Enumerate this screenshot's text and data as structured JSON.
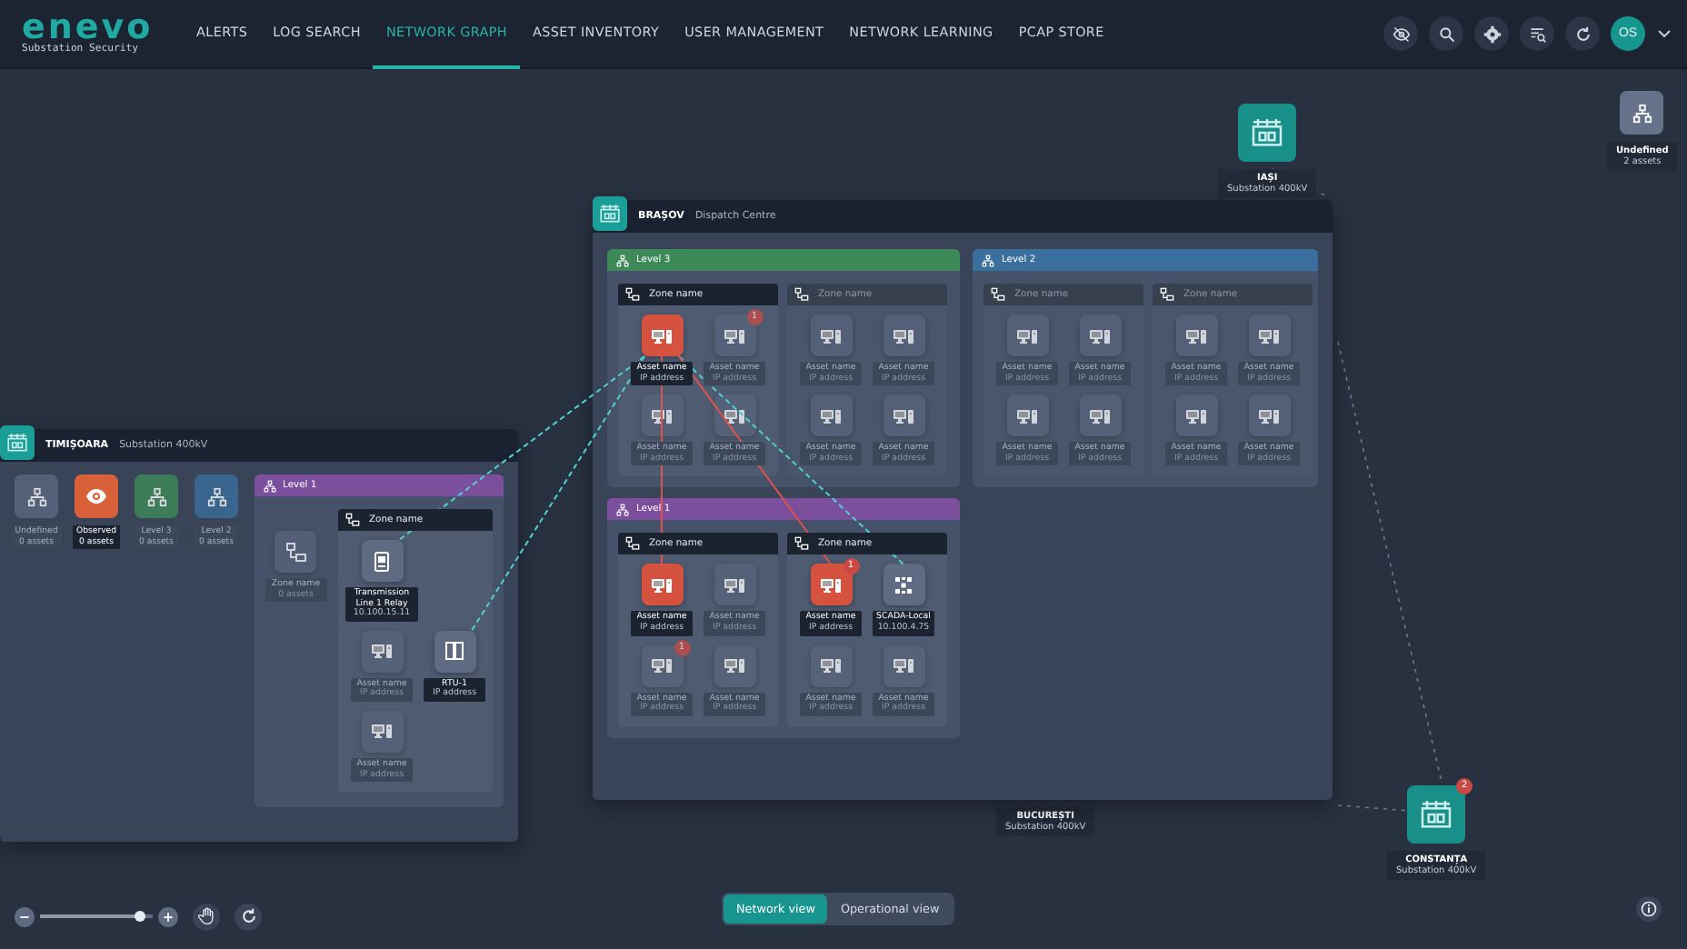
{
  "brand": {
    "logo": "enevo",
    "tagline": "Substation Security"
  },
  "nav": [
    {
      "label": "ALERTS",
      "selected": false
    },
    {
      "label": "LOG SEARCH",
      "selected": false
    },
    {
      "label": "NETWORK GRAPH",
      "selected": true
    },
    {
      "label": "ASSET INVENTORY",
      "selected": false
    },
    {
      "label": "USER MANAGEMENT",
      "selected": false
    },
    {
      "label": "NETWORK LEARNING",
      "selected": false
    },
    {
      "label": "PCAP STORE",
      "selected": false
    }
  ],
  "user": {
    "initials": "OS"
  },
  "map_sites": [
    {
      "name": "IAȘI",
      "subtitle": "Substation 400kV",
      "marker_visible": true
    },
    {
      "name": "BUCUREȘTI",
      "subtitle": "Substation 400kV",
      "marker_visible": false
    },
    {
      "name": "CONSTANȚA",
      "subtitle": "Substation 400kV",
      "marker_visible": true,
      "badge": "2"
    }
  ],
  "undefined_group": {
    "label": "Undefined",
    "count": "2 assets"
  },
  "brasov": {
    "name": "BRAȘOV",
    "subtitle": "Dispatch Centre",
    "levels": [
      {
        "label": "Level 3",
        "color": "#3d8a58",
        "zones": [
          {
            "name": "Zone name",
            "highlighted": true,
            "rows": [
              [
                {
                  "name": "Asset name",
                  "ip": "IP address",
                  "kind": "workstation",
                  "alert": true,
                  "highlighted": true
                },
                {
                  "name": "Asset name",
                  "ip": "IP address",
                  "kind": "workstation",
                  "alert": false,
                  "highlighted": false,
                  "badge": "1"
                }
              ],
              [
                {
                  "name": "Asset name",
                  "ip": "IP address",
                  "kind": "workstation",
                  "alert": false,
                  "highlighted": false
                },
                {
                  "name": "Asset name",
                  "ip": "IP address",
                  "kind": "workstation",
                  "alert": false,
                  "highlighted": false
                }
              ]
            ]
          },
          {
            "name": "Zone name",
            "highlighted": false,
            "rows": [
              [
                {
                  "name": "Asset name",
                  "ip": "IP address",
                  "kind": "workstation",
                  "alert": false,
                  "highlighted": false
                },
                {
                  "name": "Asset name",
                  "ip": "IP address",
                  "kind": "workstation",
                  "alert": false,
                  "highlighted": false
                }
              ],
              [
                {
                  "name": "Asset name",
                  "ip": "IP address",
                  "kind": "workstation",
                  "alert": false,
                  "highlighted": false
                },
                {
                  "name": "Asset name",
                  "ip": "IP address",
                  "kind": "workstation",
                  "alert": false,
                  "highlighted": false
                }
              ]
            ]
          }
        ]
      },
      {
        "label": "Level 2",
        "color": "#3a6e9c",
        "zones": [
          {
            "name": "Zone name",
            "highlighted": false,
            "rows": [
              [
                {
                  "name": "Asset name",
                  "ip": "IP address",
                  "kind": "workstation",
                  "alert": false,
                  "highlighted": false
                },
                {
                  "name": "Asset name",
                  "ip": "IP address",
                  "kind": "workstation",
                  "alert": false,
                  "highlighted": false
                }
              ],
              [
                {
                  "name": "Asset name",
                  "ip": "IP address",
                  "kind": "workstation",
                  "alert": false,
                  "highlighted": false
                },
                {
                  "name": "Asset name",
                  "ip": "IP address",
                  "kind": "workstation",
                  "alert": false,
                  "highlighted": false
                }
              ]
            ]
          },
          {
            "name": "Zone name",
            "highlighted": false,
            "rows": [
              [
                {
                  "name": "Asset name",
                  "ip": "IP address",
                  "kind": "workstation",
                  "alert": false,
                  "highlighted": false
                },
                {
                  "name": "Asset name",
                  "ip": "IP address",
                  "kind": "workstation",
                  "alert": false,
                  "highlighted": false
                }
              ],
              [
                {
                  "name": "Asset name",
                  "ip": "IP address",
                  "kind": "workstation",
                  "alert": false,
                  "highlighted": false
                },
                {
                  "name": "Asset name",
                  "ip": "IP address",
                  "kind": "workstation",
                  "alert": false,
                  "highlighted": false
                }
              ]
            ]
          }
        ]
      },
      {
        "label": "Level 1",
        "color": "#7b4f9c",
        "zones": [
          {
            "name": "Zone name",
            "highlighted": true,
            "rows": [
              [
                {
                  "name": "Asset name",
                  "ip": "IP address",
                  "kind": "workstation",
                  "alert": true,
                  "highlighted": true
                },
                {
                  "name": "Asset name",
                  "ip": "IP address",
                  "kind": "workstation",
                  "alert": false,
                  "highlighted": false
                }
              ],
              [
                {
                  "name": "Asset name",
                  "ip": "IP address",
                  "kind": "workstation",
                  "alert": false,
                  "highlighted": false,
                  "badge": "1"
                },
                {
                  "name": "Asset name",
                  "ip": "IP address",
                  "kind": "workstation",
                  "alert": false,
                  "highlighted": false
                }
              ]
            ]
          },
          {
            "name": "Zone name",
            "highlighted": true,
            "rows": [
              [
                {
                  "name": "Asset name",
                  "ip": "IP address",
                  "kind": "workstation",
                  "alert": true,
                  "highlighted": true,
                  "badge": "1"
                },
                {
                  "name": "SCADA-Local",
                  "ip": "10.100.4.75",
                  "kind": "scada",
                  "alert": false,
                  "highlighted": true
                }
              ],
              [
                {
                  "name": "Asset name",
                  "ip": "IP address",
                  "kind": "workstation",
                  "alert": false,
                  "highlighted": false
                },
                {
                  "name": "Asset name",
                  "ip": "IP address",
                  "kind": "workstation",
                  "alert": false,
                  "highlighted": false
                }
              ]
            ]
          }
        ]
      }
    ]
  },
  "timisoara": {
    "name": "TIMIȘOARA",
    "subtitle": "Substation 400kV",
    "categories": [
      {
        "label": "Undefined",
        "count": "0 assets",
        "color": "#5b6880",
        "kind": "level",
        "highlighted": false
      },
      {
        "label": "Observed",
        "count": "0 assets",
        "color": "#d8613a",
        "kind": "observed",
        "highlighted": true
      },
      {
        "label": "Level 3",
        "count": "0 assets",
        "color": "#3d8a58",
        "kind": "level",
        "highlighted": false
      },
      {
        "label": "Level 2",
        "count": "0 assets",
        "color": "#3a6e9c",
        "kind": "level",
        "highlighted": false
      }
    ],
    "level": {
      "label": "Level 1",
      "color": "#7b4f9c",
      "collapsed_zones": [
        {
          "name": "Zone name",
          "count": "0 assets"
        }
      ],
      "zones": [
        {
          "name": "Zone name",
          "highlighted": true,
          "rows": [
            [
              {
                "name": "Transmission Line 1 Relay",
                "ip": "10.100.15.11",
                "kind": "relay",
                "alert": false,
                "highlighted": true
              }
            ],
            [
              {
                "name": "Asset name",
                "ip": "IP address",
                "kind": "workstation",
                "alert": false,
                "highlighted": false
              },
              {
                "name": "RTU-1",
                "ip": "IP address",
                "kind": "rtu",
                "alert": false,
                "highlighted": true
              }
            ],
            [
              {
                "name": "Asset name",
                "ip": "IP address",
                "kind": "workstation",
                "alert": false,
                "highlighted": false
              }
            ]
          ]
        }
      ]
    }
  },
  "zoom": {
    "level": 0.88
  },
  "views": [
    {
      "label": "Network view",
      "selected": true
    },
    {
      "label": "Operational view",
      "selected": false
    }
  ]
}
